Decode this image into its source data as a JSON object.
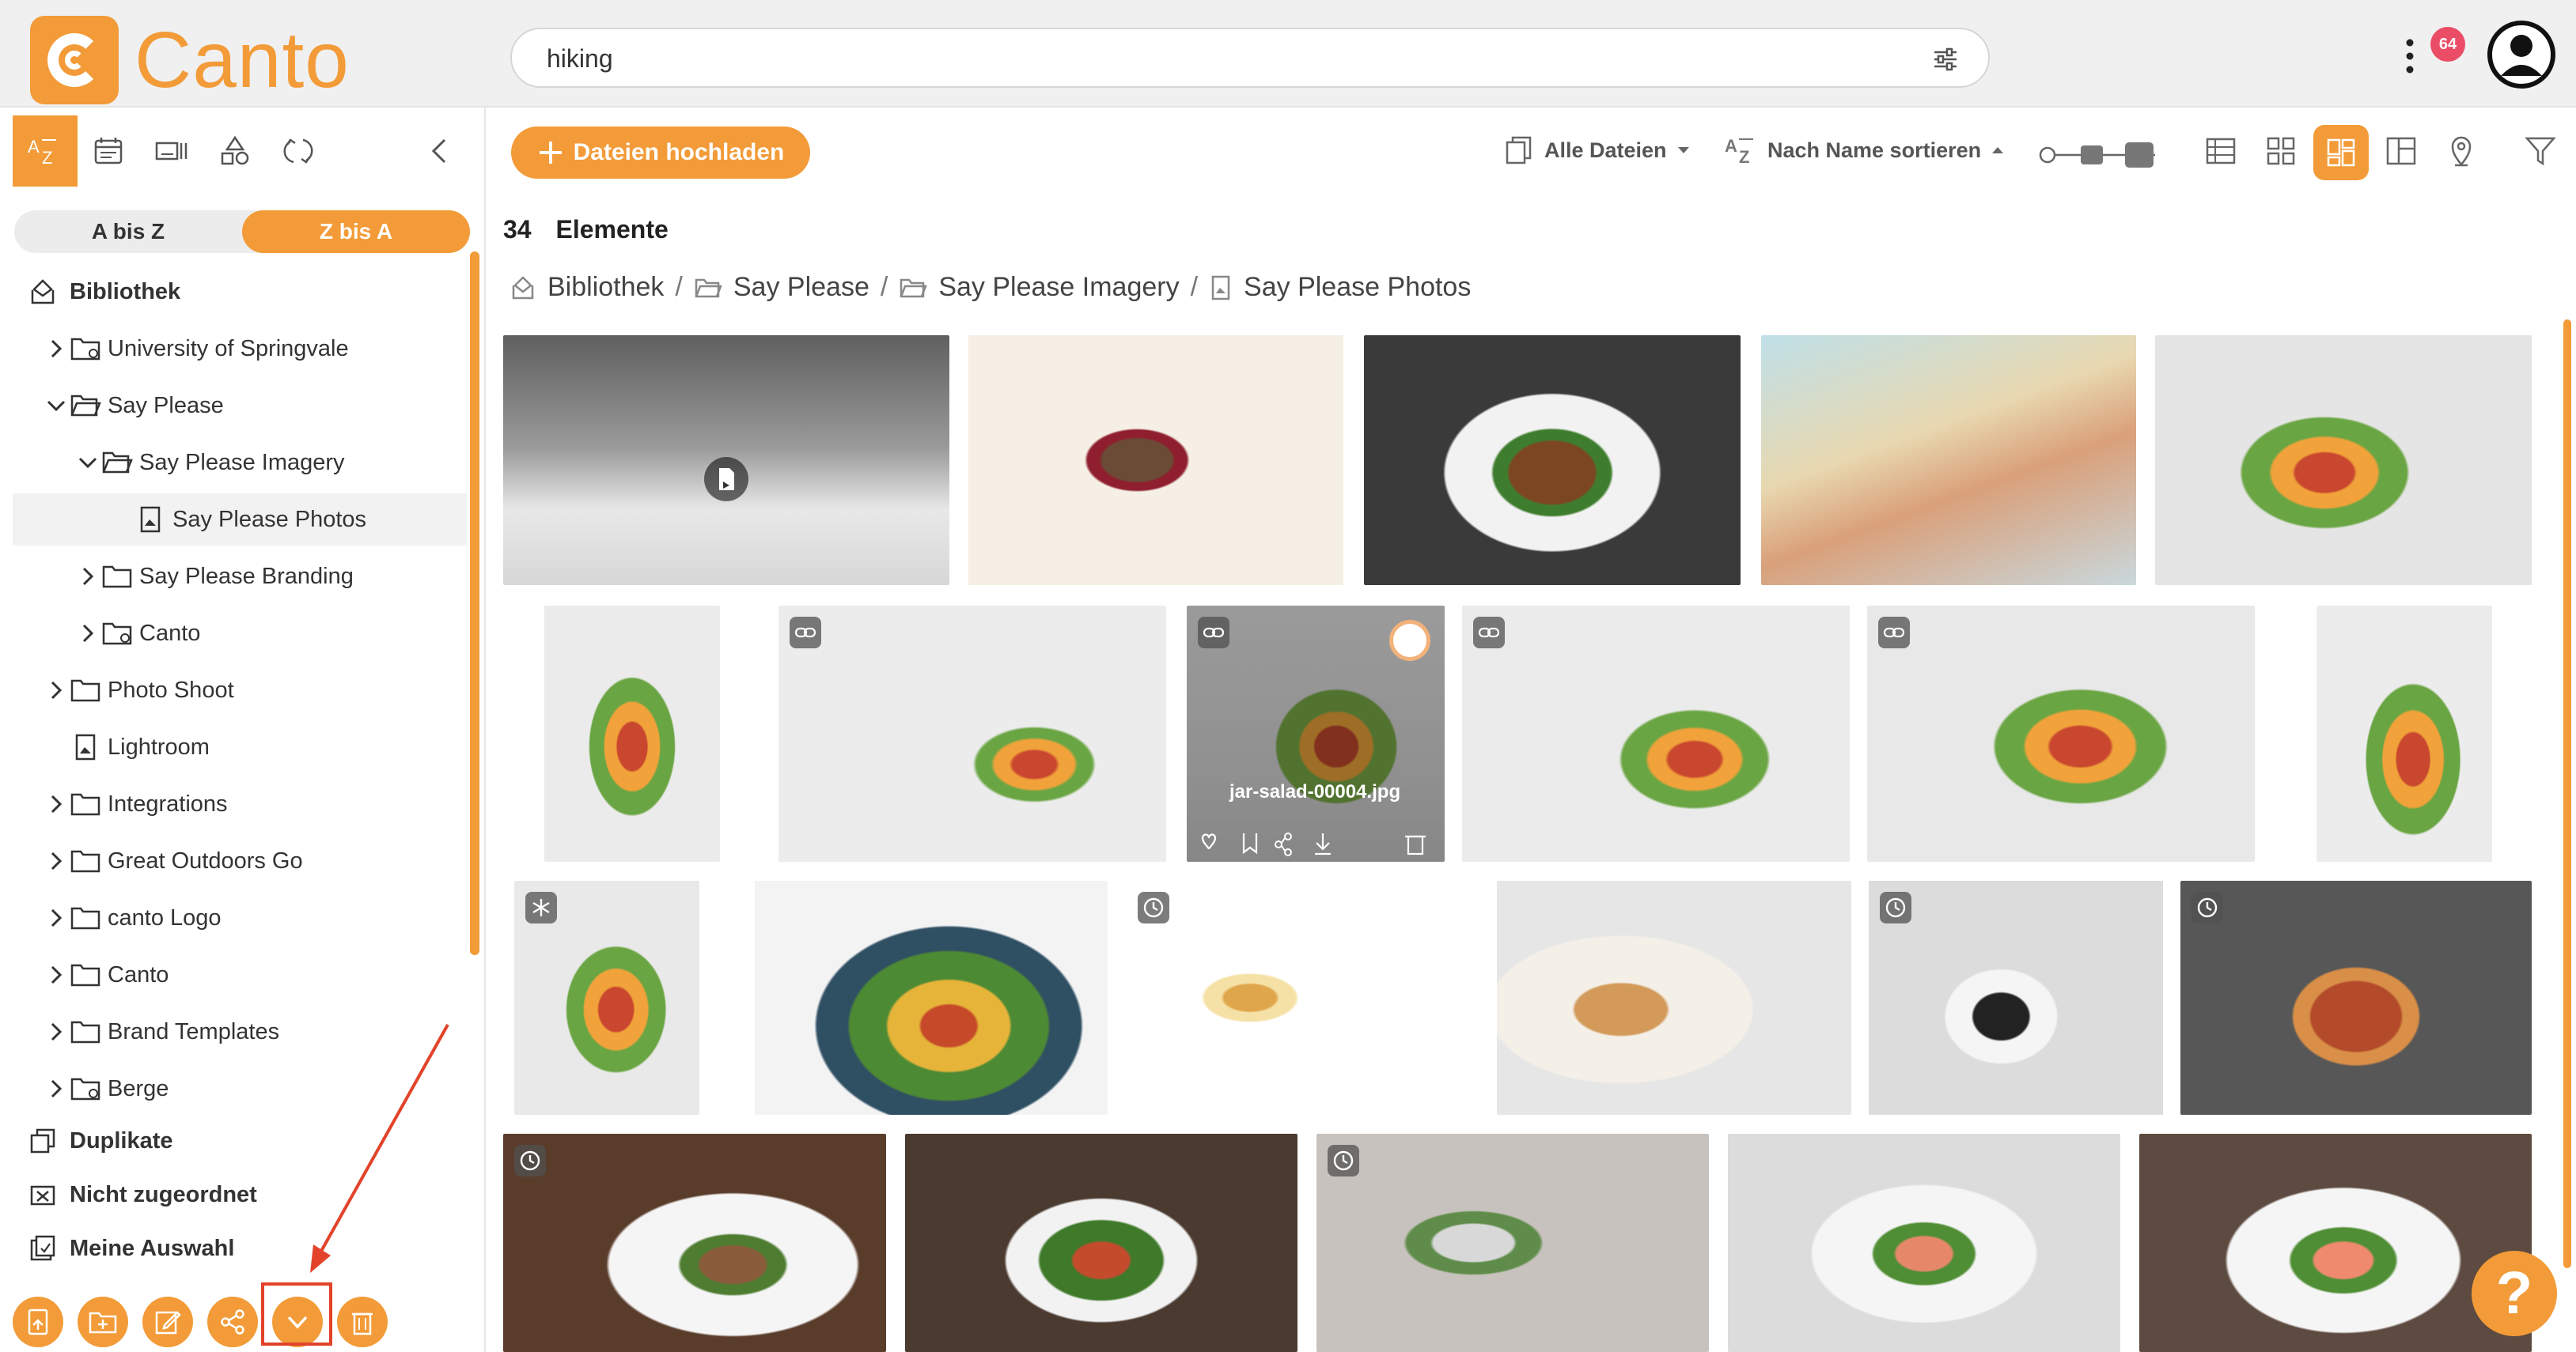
{
  "app": {
    "brand": "Canto",
    "brand_color": "#f29b38"
  },
  "search": {
    "query": "hiking"
  },
  "header": {
    "notification_count": "64"
  },
  "left_panel": {
    "sort": {
      "a_to_z": "A bis Z",
      "z_to_a": "Z bis A",
      "selected": "Z bis A"
    },
    "tree": [
      {
        "label": "Bibliothek",
        "level": 0,
        "bold": true,
        "icon": "library-icon"
      },
      {
        "label": "University of Springvale",
        "level": 1,
        "expand": "collapsed",
        "icon": "shared-folder-icon"
      },
      {
        "label": "Say Please",
        "level": 1,
        "expand": "expanded",
        "icon": "folder-open-icon"
      },
      {
        "label": "Say Please Imagery",
        "level": 2,
        "expand": "expanded",
        "icon": "folder-open-icon"
      },
      {
        "label": "Say Please Photos",
        "level": 3,
        "expand": "none",
        "icon": "album-icon",
        "selected": true
      },
      {
        "label": "Say Please Branding",
        "level": 2,
        "expand": "collapsed",
        "icon": "folder-icon"
      },
      {
        "label": "Canto",
        "level": 2,
        "expand": "collapsed",
        "icon": "shared-folder-icon"
      },
      {
        "label": "Photo Shoot",
        "level": 1,
        "expand": "collapsed",
        "icon": "folder-icon"
      },
      {
        "label": "Lightroom",
        "level": 1,
        "expand": "none",
        "icon": "album-icon"
      },
      {
        "label": "Integrations",
        "level": 1,
        "expand": "collapsed",
        "icon": "folder-icon"
      },
      {
        "label": "Great Outdoors Go",
        "level": 1,
        "expand": "collapsed",
        "icon": "folder-icon"
      },
      {
        "label": "canto Logo",
        "level": 1,
        "expand": "collapsed",
        "icon": "folder-icon"
      },
      {
        "label": "Canto",
        "level": 1,
        "expand": "collapsed",
        "icon": "folder-icon"
      },
      {
        "label": "Brand Templates",
        "level": 1,
        "expand": "collapsed",
        "icon": "folder-icon"
      },
      {
        "label": "Berge",
        "level": 1,
        "expand": "collapsed",
        "icon": "shared-folder-icon"
      },
      {
        "label": "Duplikate",
        "level": 0,
        "bold": true,
        "icon": "duplicates-icon"
      },
      {
        "label": "Nicht zugeordnet",
        "level": 0,
        "bold": true,
        "icon": "unassigned-icon"
      },
      {
        "label": "Meine Auswahl",
        "level": 0,
        "bold": true,
        "icon": "my-selection-icon"
      }
    ]
  },
  "toolbar": {
    "upload_label": "Dateien hochladen",
    "filter_label": "Alle Dateien",
    "sort_label": "Nach Name sortieren"
  },
  "results": {
    "count": "34",
    "count_label": "Elemente"
  },
  "breadcrumb": [
    "Bibliothek",
    "Say Please",
    "Say Please Imagery",
    "Say Please Photos"
  ],
  "hover_tile": {
    "filename": "jar-salad-00004.jpg"
  },
  "help": {
    "label": "?"
  }
}
